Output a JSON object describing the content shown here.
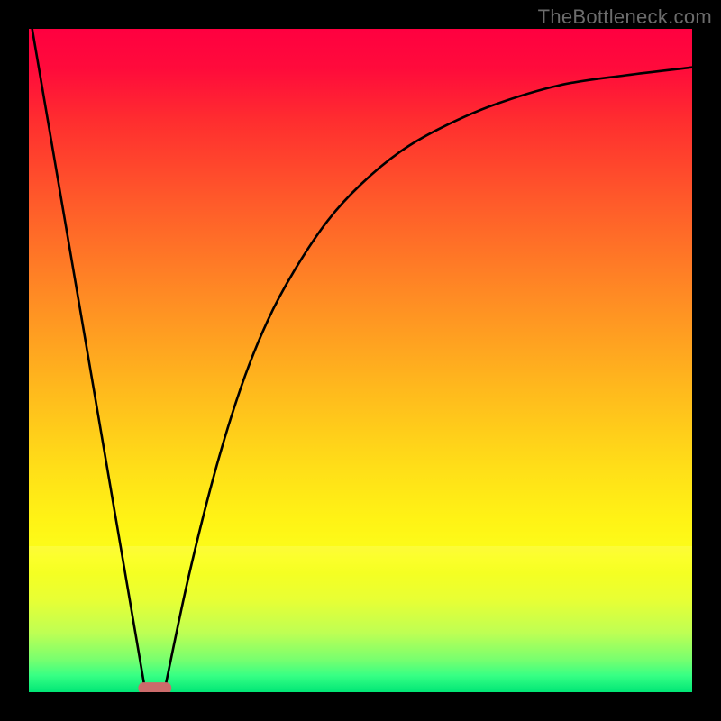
{
  "watermark": "TheBottleneck.com",
  "chart_data": {
    "type": "line",
    "title": "",
    "xlabel": "",
    "ylabel": "",
    "xlim": [
      0,
      100
    ],
    "ylim": [
      0,
      100
    ],
    "series": [
      {
        "name": "left-linear-segment",
        "x": [
          0.5,
          17.5
        ],
        "values": [
          100,
          0.5
        ]
      },
      {
        "name": "right-curve",
        "x": [
          20.5,
          24,
          28,
          32,
          36,
          40,
          45,
          50,
          56,
          62,
          70,
          80,
          90,
          100
        ],
        "values": [
          0.5,
          17,
          33,
          46,
          56,
          63.5,
          71,
          76.5,
          81.5,
          85,
          88.5,
          91.5,
          93,
          94.2
        ]
      }
    ],
    "marker": {
      "name": "min-marker-pill",
      "x_center": 19,
      "x_halfwidth": 2.5,
      "y": 0.6,
      "color": "#cc6b6b"
    },
    "gradient_stops": [
      {
        "pos": 0.0,
        "color": "#ff0040"
      },
      {
        "pos": 0.25,
        "color": "#ff6a27"
      },
      {
        "pos": 0.55,
        "color": "#ffc81c"
      },
      {
        "pos": 0.78,
        "color": "#fff814"
      },
      {
        "pos": 0.92,
        "color": "#b5ff58"
      },
      {
        "pos": 1.0,
        "color": "#00e676"
      }
    ]
  }
}
